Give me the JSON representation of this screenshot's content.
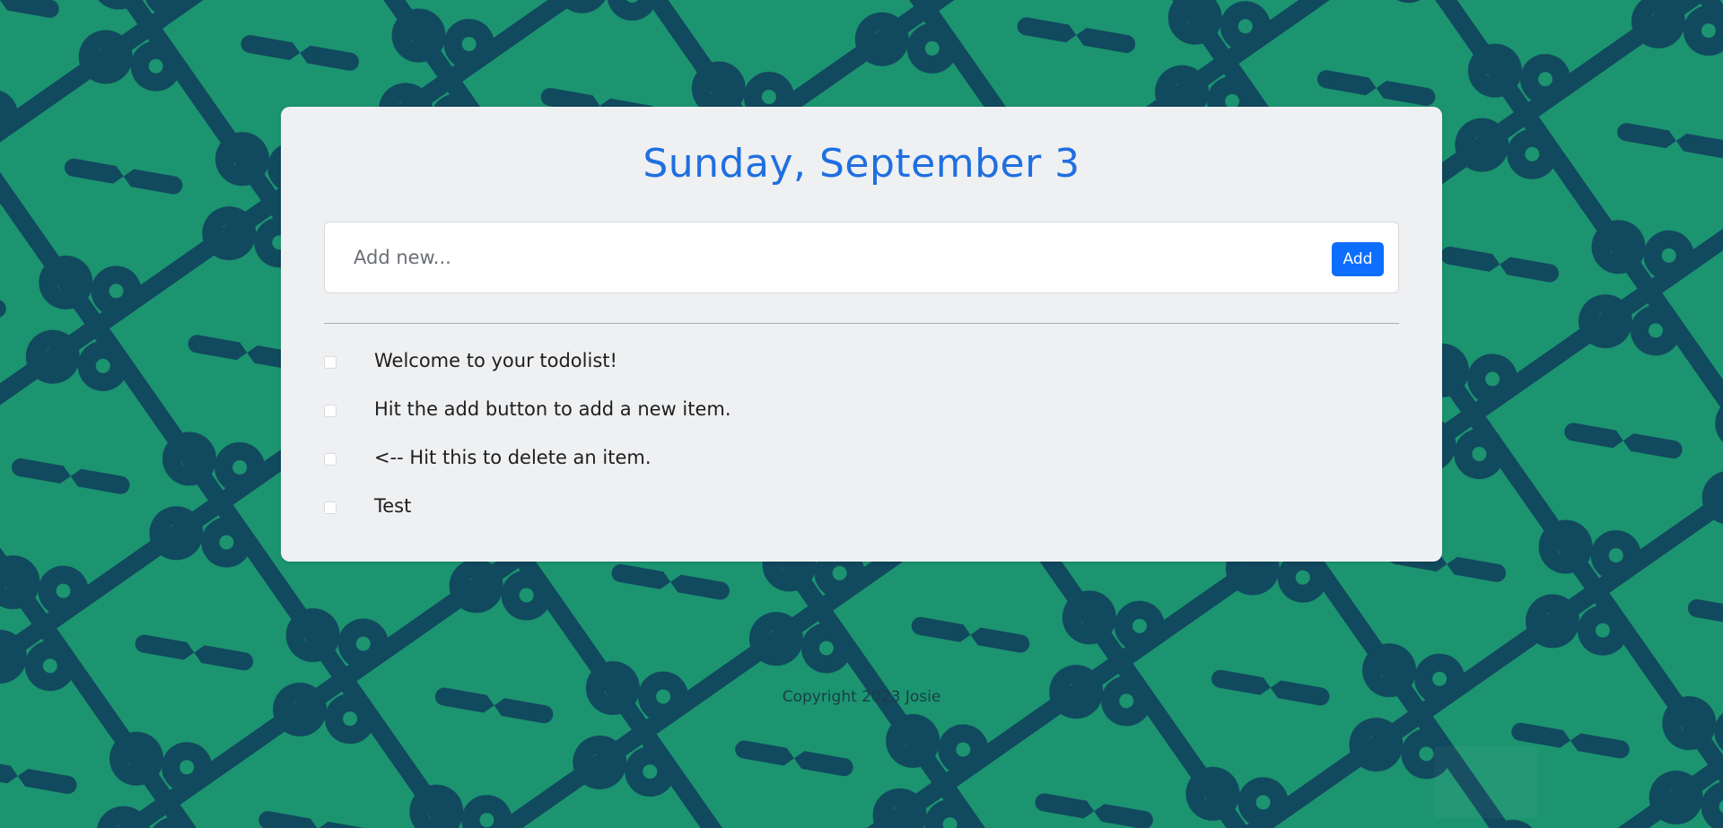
{
  "page": {
    "background_color": "#1c9470",
    "pattern_color": "#11495e"
  },
  "header": {
    "title": "Sunday, September 3"
  },
  "form": {
    "placeholder": "Add new...",
    "add_label": "Add",
    "accent_color": "#0d6efd"
  },
  "items": [
    {
      "label": "Welcome to your todolist!",
      "checked": false
    },
    {
      "label": "Hit the add button to add a new item.",
      "checked": false
    },
    {
      "label": "<-- Hit this to delete an item.",
      "checked": false
    },
    {
      "label": "Test",
      "checked": false
    }
  ],
  "footer": {
    "text": "Copyright 2023 Josie"
  }
}
